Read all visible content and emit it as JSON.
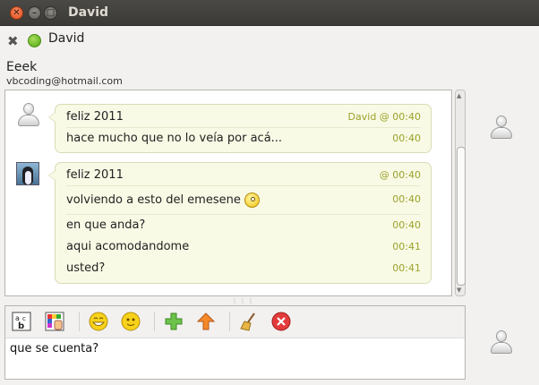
{
  "window": {
    "title": "David"
  },
  "header": {
    "contact_name": "David",
    "nick": "Eeek",
    "email": "vbcoding@hotmail.com",
    "status_color": "#5cb31a"
  },
  "conversation": {
    "messages": [
      {
        "sender": "David",
        "lines": [
          {
            "text": "feliz 2011",
            "time": "David @ 00:40"
          },
          {
            "text": "hace mucho que no lo veía por acá...",
            "time": "00:40"
          }
        ]
      },
      {
        "sender": "",
        "lines": [
          {
            "text": "feliz 2011",
            "time": "@ 00:40"
          },
          {
            "text": "volviendo a esto del emesene",
            "time": "00:40",
            "emoticon": "smile-emoticon"
          },
          {
            "text": "en que anda?",
            "time": "00:40"
          },
          {
            "text": "aqui acomodandome",
            "time": "00:41"
          },
          {
            "text": "usted?",
            "time": "00:41"
          }
        ]
      }
    ]
  },
  "toolbar": {
    "buttons": [
      "font-icon",
      "color-icon",
      "emoticon-icon",
      "wink-icon",
      "invite-icon",
      "send-file-icon",
      "clean-icon",
      "block-icon"
    ]
  },
  "input": {
    "value": "que se cuenta?"
  },
  "colors": {
    "time": "#9aa12a",
    "bubble_bg": "#f9fae5",
    "bubble_border": "#d9dbb6"
  }
}
